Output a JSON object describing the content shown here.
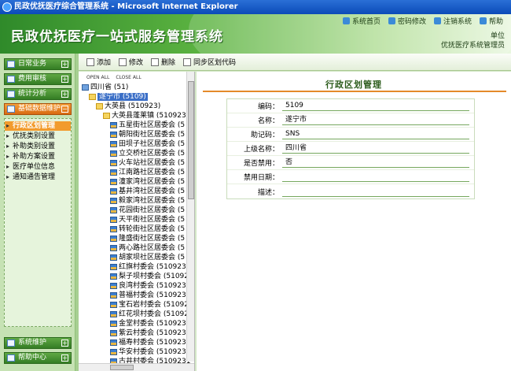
{
  "window": {
    "title": "民政优抚医疗综合管理系统 - Microsoft Internet Explorer"
  },
  "header": {
    "system_name": "民政优抚医疗一站式服务管理系统",
    "links": [
      {
        "label": "系统首页",
        "icon": "home-icon"
      },
      {
        "label": "密码修改",
        "icon": "key-icon"
      },
      {
        "label": "注销系统",
        "icon": "logout-icon"
      },
      {
        "label": "帮助",
        "icon": "help-icon"
      }
    ],
    "unit_label": "单位",
    "user_label": "优抚医疗系统管理员"
  },
  "sidebar": {
    "sections": [
      {
        "label": "日常业务",
        "expanded": false
      },
      {
        "label": "费用审核",
        "expanded": false
      },
      {
        "label": "统计分析",
        "expanded": false
      },
      {
        "label": "基础数据维护",
        "expanded": true
      }
    ],
    "sub_items": [
      {
        "label": "行政区划管理",
        "active": true
      },
      {
        "label": "优抚类别设置",
        "active": false
      },
      {
        "label": "补助类别设置",
        "active": false
      },
      {
        "label": "补助方案设置",
        "active": false
      },
      {
        "label": "医疗单位信息",
        "active": false
      },
      {
        "label": "通知通告管理",
        "active": false
      }
    ],
    "bottom_sections": [
      {
        "label": "系统维护"
      },
      {
        "label": "帮助中心"
      }
    ]
  },
  "toolbar": {
    "buttons": [
      {
        "label": "添加",
        "icon": "add-icon"
      },
      {
        "label": "修改",
        "icon": "edit-icon"
      },
      {
        "label": "删除",
        "icon": "delete-icon"
      },
      {
        "label": "同步区划代码",
        "icon": "sync-icon"
      }
    ]
  },
  "tree": {
    "open_all": "OPEN ALL",
    "close_all": "CLOSE ALL",
    "nodes": [
      {
        "label": "四川省 (51)",
        "level": 0,
        "type": "pc",
        "selected": false
      },
      {
        "label": "遂宁市 (5109)",
        "level": 1,
        "type": "folder",
        "selected": true
      },
      {
        "label": "大英县 (510923)",
        "level": 2,
        "type": "folder",
        "selected": false
      },
      {
        "label": "大英县蓬莱镇 (510923100",
        "level": 3,
        "type": "folder",
        "selected": false
      },
      {
        "label": "五星街社区居委会 (5",
        "level": 4,
        "type": "village",
        "selected": false
      },
      {
        "label": "朝阳街社区居委会 (5",
        "level": 4,
        "type": "village",
        "selected": false
      },
      {
        "label": "田坝子社区居委会 (5",
        "level": 4,
        "type": "village",
        "selected": false
      },
      {
        "label": "立交桥社区居委会 (5",
        "level": 4,
        "type": "village",
        "selected": false
      },
      {
        "label": "火车站社区居委会 (5",
        "level": 4,
        "type": "village",
        "selected": false
      },
      {
        "label": "江南路社区居委会 (5",
        "level": 4,
        "type": "village",
        "selected": false
      },
      {
        "label": "潼家湾社区居委会 (5",
        "level": 4,
        "type": "village",
        "selected": false
      },
      {
        "label": "基井湾社区居委会 (5",
        "level": 4,
        "type": "village",
        "selected": false
      },
      {
        "label": "毅家湾社区居委会 (5",
        "level": 4,
        "type": "village",
        "selected": false
      },
      {
        "label": "花园街社区居委会 (5",
        "level": 4,
        "type": "village",
        "selected": false
      },
      {
        "label": "天平街社区居委会 (5",
        "level": 4,
        "type": "village",
        "selected": false
      },
      {
        "label": "转轮街社区居委会 (5",
        "level": 4,
        "type": "village",
        "selected": false
      },
      {
        "label": "隆盛街社区居委会 (5",
        "level": 4,
        "type": "village",
        "selected": false
      },
      {
        "label": "两心路社区居委会 (5",
        "level": 4,
        "type": "village",
        "selected": false
      },
      {
        "label": "胡家坝社区居委会 (5",
        "level": 4,
        "type": "village",
        "selected": false
      },
      {
        "label": "红旗村委会 (5109231",
        "level": 4,
        "type": "village",
        "selected": false
      },
      {
        "label": "梨子坝村委会 (51092",
        "level": 4,
        "type": "village",
        "selected": false
      },
      {
        "label": "良湾村委会 (5109231",
        "level": 4,
        "type": "village",
        "selected": false
      },
      {
        "label": "普福村委会 (5109231",
        "level": 4,
        "type": "village",
        "selected": false
      },
      {
        "label": "宝石岩村委会 (51092",
        "level": 4,
        "type": "village",
        "selected": false
      },
      {
        "label": "红花坝村委会 (51092",
        "level": 4,
        "type": "village",
        "selected": false
      },
      {
        "label": "金堂村委会 (5109231",
        "level": 4,
        "type": "village",
        "selected": false
      },
      {
        "label": "紫云村委会 (5109231",
        "level": 4,
        "type": "village",
        "selected": false
      },
      {
        "label": "福寿村委会 (5109231",
        "level": 4,
        "type": "village",
        "selected": false
      },
      {
        "label": "华安村委会 (5109231",
        "level": 4,
        "type": "village",
        "selected": false
      },
      {
        "label": "古井村委会 (5109231",
        "level": 4,
        "type": "village",
        "selected": false
      }
    ]
  },
  "form": {
    "title": "行政区划管理",
    "fields": [
      {
        "label": "编码：",
        "value": "5109"
      },
      {
        "label": "名称：",
        "value": "遂宁市"
      },
      {
        "label": "助记码：",
        "value": "SNS"
      },
      {
        "label": "上级名称：",
        "value": "四川省"
      },
      {
        "label": "是否禁用：",
        "value": "否"
      },
      {
        "label": "禁用日期：",
        "value": ""
      },
      {
        "label": "描述：",
        "value": ""
      }
    ]
  }
}
